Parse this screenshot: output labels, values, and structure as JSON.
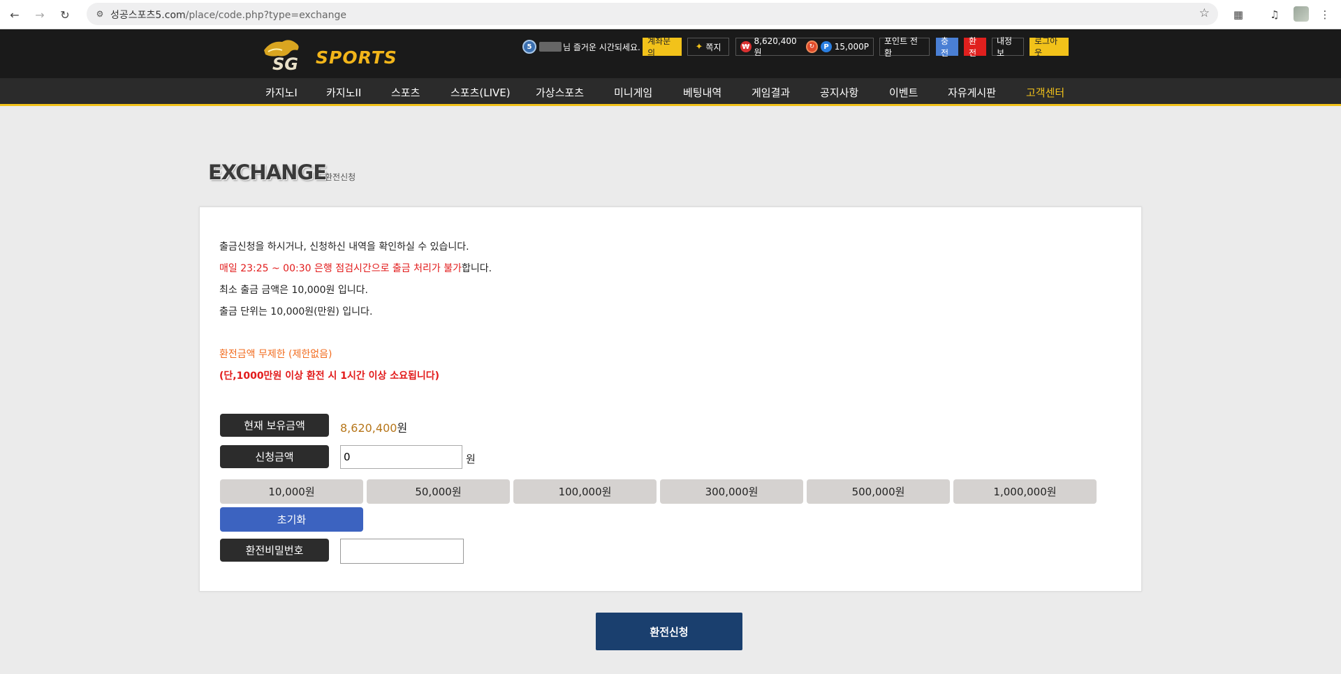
{
  "browser": {
    "url_host": "성공스포츠5.com",
    "url_path": "/place/code.php?type=exchange"
  },
  "header": {
    "brand": "SPORTS",
    "greeting": "님 즐거운 시간되세요.",
    "level_badge": "5",
    "account_inquiry": "계좌문의",
    "messages": "쪽지",
    "balance": "8,620,400원",
    "points": "15,000P",
    "point_convert": "포인트 전환",
    "deposit": "충전",
    "withdraw": "환전",
    "my_info": "내정보",
    "logout": "로그아웃"
  },
  "nav": {
    "items": [
      "카지노I",
      "카지노II",
      "스포츠",
      "스포츠(LIVE)",
      "가상스포츠",
      "미니게임",
      "베팅내역",
      "게임결과",
      "공지사항",
      "이벤트",
      "자유게시판",
      "고객센터"
    ],
    "active_index": 11
  },
  "page": {
    "title": "EXCHANGE",
    "subtitle": "환전신청"
  },
  "notice": {
    "line1": "출금신청을 하시거나, 신청하신 내역을 확인하실 수 있습니다.",
    "line2_red": "매일 23:25 ~ 00:30 은행 점검시간으로 출금 처리가 불가",
    "line2_rest": "합니다.",
    "line3": "최소 출금 금액은 10,000원 입니다.",
    "line4": "출금 단위는 10,000원(만원) 입니다.",
    "line5": "환전금액 무제한 (제한없음)",
    "line6": "(단,1000만원 이상 환전 시 1시간 이상 소요됩니다)"
  },
  "form": {
    "balance_label": "현재 보유금액",
    "balance_value": "8,620,400",
    "balance_unit": "원",
    "amount_label": "신청금액",
    "amount_value": "0",
    "amount_unit": "원",
    "quick_amounts": [
      "10,000원",
      "50,000원",
      "100,000원",
      "300,000원",
      "500,000원",
      "1,000,000원"
    ],
    "reset_label": "초기화",
    "password_label": "환전비밀번호",
    "submit_label": "환전신청"
  },
  "colors": {
    "accent_yellow": "#f2c21a",
    "submit_navy": "#1a3f6e",
    "reset_blue": "#3c63c0",
    "notice_red": "#e21b1b",
    "notice_orange": "#f26b1d"
  }
}
